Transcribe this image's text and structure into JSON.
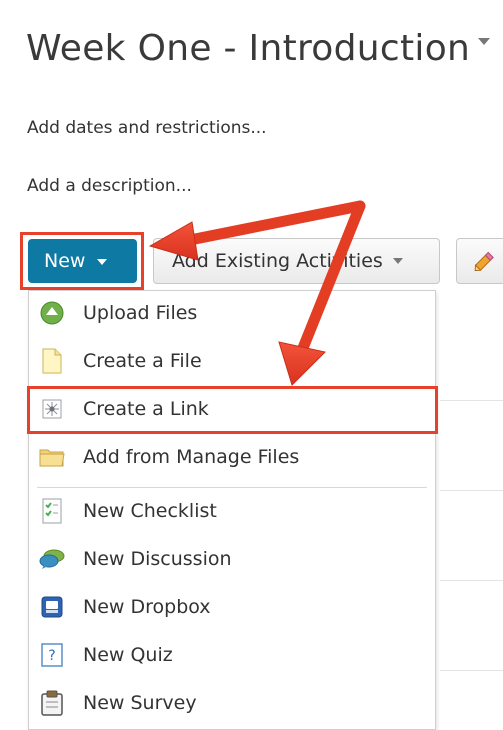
{
  "module": {
    "title": "Week One - Introduction",
    "add_dates_label": "Add dates and restrictions...",
    "add_description_label": "Add a description..."
  },
  "toolbar": {
    "new_label": "New",
    "add_existing_label": "Add Existing Activities"
  },
  "new_menu": {
    "items": [
      {
        "label": "Upload Files",
        "icon": "upload-icon"
      },
      {
        "label": "Create a File",
        "icon": "file-icon"
      },
      {
        "label": "Create a Link",
        "icon": "link-icon"
      },
      {
        "label": "Add from Manage Files",
        "icon": "folder-icon"
      },
      {
        "label": "New Checklist",
        "icon": "checklist-icon"
      },
      {
        "label": "New Discussion",
        "icon": "discussion-icon"
      },
      {
        "label": "New Dropbox",
        "icon": "dropbox-icon"
      },
      {
        "label": "New Quiz",
        "icon": "quiz-icon"
      },
      {
        "label": "New Survey",
        "icon": "survey-icon"
      }
    ]
  },
  "colors": {
    "primary_button": "#0e79a3",
    "highlight": "#e8412b"
  }
}
